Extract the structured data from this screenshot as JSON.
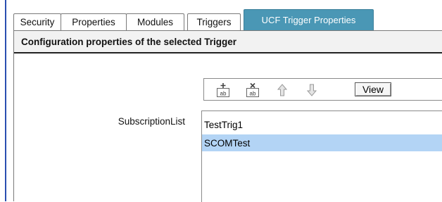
{
  "tabs": [
    {
      "label": "Security",
      "active": false
    },
    {
      "label": "Properties",
      "active": false
    },
    {
      "label": "Modules",
      "active": false
    },
    {
      "label": "Triggers",
      "active": false
    },
    {
      "label": "UCF Trigger Properties",
      "active": true
    }
  ],
  "header": {
    "title": "Configuration properties of the selected Trigger"
  },
  "toolbar": {
    "icons": [
      "add-item-icon",
      "remove-item-icon",
      "move-up-icon",
      "move-down-icon"
    ],
    "view_label": "View"
  },
  "subscription": {
    "label": "SubscriptionList",
    "items": [
      "TestTrig1",
      "SCOMTest"
    ],
    "selected_index": 1
  },
  "colors": {
    "active_tab": "#4a97b5",
    "selection": "#b3d4f5",
    "window_border": "#2a4fb0"
  }
}
